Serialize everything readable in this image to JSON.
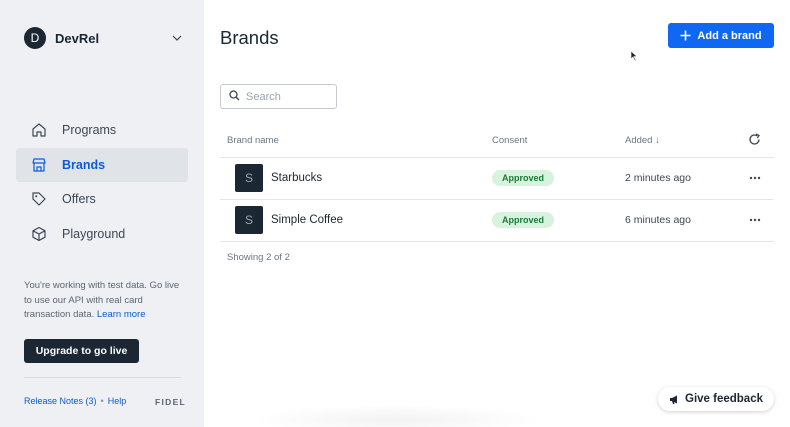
{
  "account": {
    "initial": "D",
    "name": "DevRel"
  },
  "nav": {
    "items": [
      {
        "label": "Programs",
        "icon": "home-icon"
      },
      {
        "label": "Brands",
        "icon": "store-icon",
        "active": true
      },
      {
        "label": "Offers",
        "icon": "tag-icon"
      },
      {
        "label": "Playground",
        "icon": "cube-icon"
      }
    ]
  },
  "test_note": {
    "text": "You're working with test data. Go live to use our API with real card transaction data. ",
    "link": "Learn more"
  },
  "upgrade_label": "Upgrade to go live",
  "footer": {
    "release_notes": "Release Notes (3)",
    "separator": "•",
    "help": "Help",
    "logo": "FIDEL"
  },
  "header": {
    "title": "Brands",
    "add_button": "Add a brand"
  },
  "search": {
    "placeholder": "Search",
    "value": ""
  },
  "table": {
    "columns": {
      "brand": "Brand name",
      "consent": "Consent",
      "added": "Added ↓"
    },
    "rows": [
      {
        "initial": "S",
        "name": "Starbucks",
        "consent": "Approved",
        "added": "2 minutes ago"
      },
      {
        "initial": "S",
        "name": "Simple Coffee",
        "consent": "Approved",
        "added": "6 minutes ago"
      }
    ],
    "summary": "Showing 2 of 2"
  },
  "feedback_label": "Give feedback",
  "colors": {
    "primary": "#1068f2",
    "sidebar_bg": "#eef0f3",
    "dark": "#1b2733",
    "approved_bg": "#d7f2dd",
    "approved_text": "#1c7a36"
  }
}
